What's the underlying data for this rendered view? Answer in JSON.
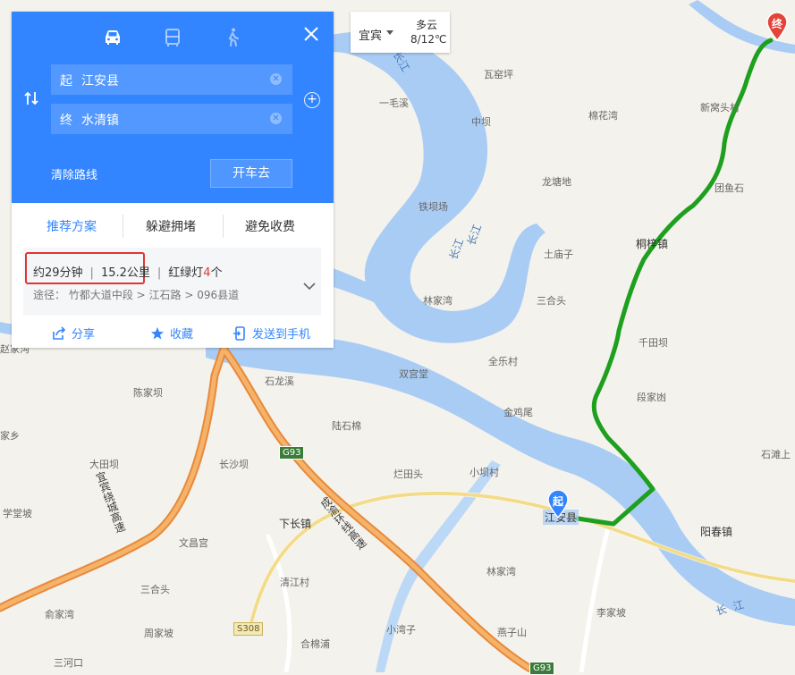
{
  "map": {
    "places": [
      {
        "id": "waziping",
        "name": "瓦窑坪"
      },
      {
        "id": "yimaoxi",
        "name": "一毛溪"
      },
      {
        "id": "zhongba",
        "name": "中坝"
      },
      {
        "id": "mianhuawan",
        "name": "棉花湾"
      },
      {
        "id": "xinwotoucun",
        "name": "新窝头村"
      },
      {
        "id": "longtandi",
        "name": "龙塘地"
      },
      {
        "id": "tieba",
        "name": "铁坝场"
      },
      {
        "id": "tuanyushi",
        "name": "团鱼石"
      },
      {
        "id": "tongzizhen",
        "name": "桐梓镇"
      },
      {
        "id": "tumiaozi",
        "name": "土庙子"
      },
      {
        "id": "linjiawan1",
        "name": "林家湾"
      },
      {
        "id": "sanhetou1",
        "name": "三合头"
      },
      {
        "id": "qiantianba",
        "name": "千田坝"
      },
      {
        "id": "quanleicun",
        "name": "全乐村"
      },
      {
        "id": "shuanggongtang",
        "name": "双宫堂"
      },
      {
        "id": "duanjiaao",
        "name": "段家凼"
      },
      {
        "id": "shilongxi",
        "name": "石龙溪"
      },
      {
        "id": "jinjiwei",
        "name": "金鸡尾"
      },
      {
        "id": "chenjiaba",
        "name": "陈家坝"
      },
      {
        "id": "lushimian",
        "name": "陆石棉"
      },
      {
        "id": "shitanshang",
        "name": "石滩上"
      },
      {
        "id": "datianba",
        "name": "大田坝"
      },
      {
        "id": "changshaba",
        "name": "长沙坝"
      },
      {
        "id": "lantiantou",
        "name": "烂田头"
      },
      {
        "id": "xiaobacun",
        "name": "小坝村"
      },
      {
        "id": "xuetangpo",
        "name": "学堂坡"
      },
      {
        "id": "xiachangzhen",
        "name": "下长镇"
      },
      {
        "id": "yangchunzhen",
        "name": "阳春镇"
      },
      {
        "id": "wenchangong",
        "name": "文昌宫"
      },
      {
        "id": "linjiawan2",
        "name": "林家湾"
      },
      {
        "id": "qingjiangcun",
        "name": "清江村"
      },
      {
        "id": "sanhetou2",
        "name": "三合头"
      },
      {
        "id": "yujiawan",
        "name": "俞家湾"
      },
      {
        "id": "lijiapo",
        "name": "李家坡"
      },
      {
        "id": "zhoujiapo",
        "name": "周家坡"
      },
      {
        "id": "xiaowanzi",
        "name": "小湾子"
      },
      {
        "id": "yanzishan",
        "name": "燕子山"
      },
      {
        "id": "hemianpu",
        "name": "合棉浦"
      },
      {
        "id": "sanhekou",
        "name": "三河口"
      },
      {
        "id": "zhaojiagou",
        "name": "赵家沟"
      },
      {
        "id": "jiaxiang",
        "name": "家乡"
      },
      {
        "id": "jianganxian_label",
        "name": "江安县"
      }
    ],
    "rivers": [
      {
        "id": "changjiang-a",
        "name": "长江"
      },
      {
        "id": "changjiang-b",
        "name": "长江"
      },
      {
        "id": "changjiang-c",
        "name": "长江"
      },
      {
        "id": "changjiang-d",
        "name": "长江"
      }
    ],
    "highway_names": [
      "宜宾绕城高速",
      "成渝环线高速"
    ],
    "road_shields": [
      "G93",
      "S308",
      "G93"
    ],
    "start_marker": "起",
    "end_marker": "终"
  },
  "panel": {
    "modes": [
      {
        "id": "car",
        "label": "驾车",
        "active": true
      },
      {
        "id": "bus",
        "label": "公交",
        "active": false
      },
      {
        "id": "walk",
        "label": "步行",
        "active": false
      }
    ],
    "origin": {
      "tag": "起",
      "value": "江安县"
    },
    "destination": {
      "tag": "终",
      "value": "水清镇"
    },
    "clear_route": "清除路线",
    "drive_button": "开车去",
    "tabs": [
      "推荐方案",
      "躲避拥堵",
      "避免收费"
    ],
    "summary": {
      "time": "约29分钟",
      "distance": "15.2公里",
      "lights_label": "红绿灯",
      "lights_count": "4",
      "lights_unit": "个",
      "via_label": "途径：",
      "via": "竹都大道中段",
      "via2": "江石路",
      "via3": "096县道"
    },
    "actions": {
      "share": "分享",
      "save": "收藏",
      "send": "发送到手机"
    }
  },
  "weather": {
    "city": "宜宾",
    "condition": "多云",
    "temp": "8/12℃"
  },
  "colors": {
    "accent": "#3385ff",
    "route": "#1ea01e",
    "highlight": "#e23434",
    "water": "#a9ccf5",
    "highway": "#f0a14a"
  }
}
